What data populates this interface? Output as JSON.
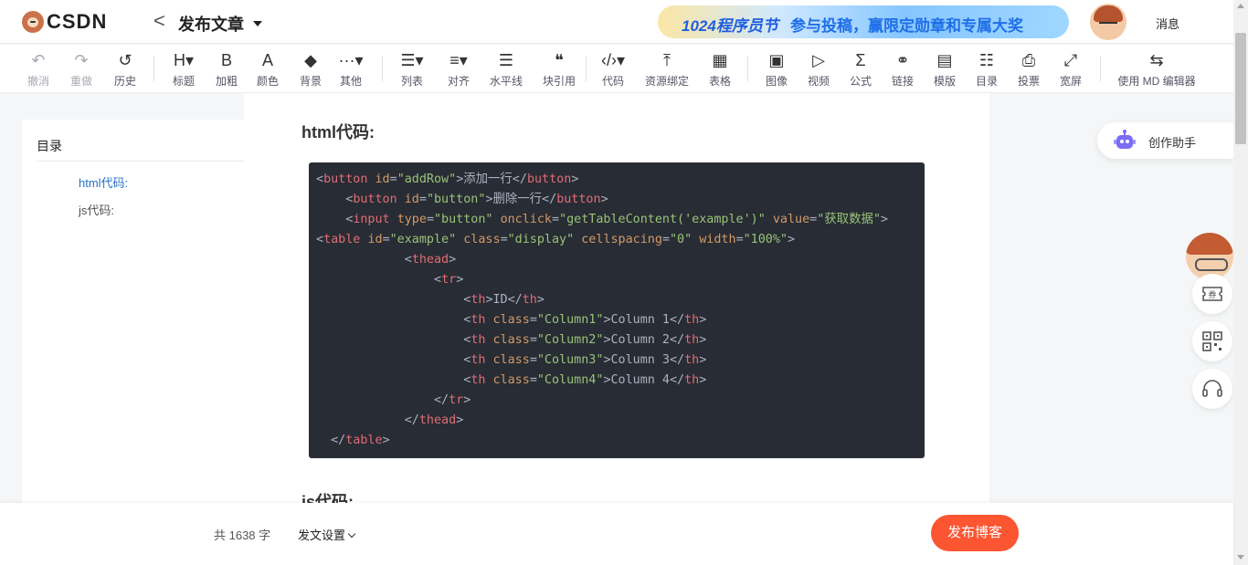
{
  "header": {
    "logo_text": "CSDN",
    "back_label": "<",
    "title": "发布文章",
    "banner_left": "1024程序员节",
    "banner_right": "参与投稿，赢限定勋章和专属大奖",
    "messages_label": "消息"
  },
  "toolbar": {
    "items": [
      {
        "label": "撤消",
        "icon": "undo-icon",
        "glyph": "↶"
      },
      {
        "label": "重做",
        "icon": "redo-icon",
        "glyph": "↷"
      },
      {
        "label": "历史",
        "icon": "history-icon",
        "glyph": "↺"
      },
      {
        "label": "标题",
        "icon": "heading-icon",
        "glyph": "H▾"
      },
      {
        "label": "加粗",
        "icon": "bold-icon",
        "glyph": "B"
      },
      {
        "label": "颜色",
        "icon": "font-color-icon",
        "glyph": "A"
      },
      {
        "label": "背景",
        "icon": "background-color-icon",
        "glyph": "◆"
      },
      {
        "label": "其他",
        "icon": "more-icon",
        "glyph": "···▾"
      },
      {
        "label": "列表",
        "icon": "list-icon",
        "glyph": "☰▾"
      },
      {
        "label": "对齐",
        "icon": "align-icon",
        "glyph": "≡▾"
      },
      {
        "label": "水平线",
        "icon": "horizontal-line-icon",
        "glyph": "☰"
      },
      {
        "label": "块引用",
        "icon": "blockquote-icon",
        "glyph": "❝"
      },
      {
        "label": "代码",
        "icon": "code-icon",
        "glyph": "‹/›▾"
      },
      {
        "label": "资源绑定",
        "icon": "resource-bind-icon",
        "glyph": "⤒"
      },
      {
        "label": "表格",
        "icon": "table-icon",
        "glyph": "▦"
      },
      {
        "label": "图像",
        "icon": "image-icon",
        "glyph": "▣"
      },
      {
        "label": "视频",
        "icon": "video-icon",
        "glyph": "▷"
      },
      {
        "label": "公式",
        "icon": "formula-icon",
        "glyph": "Σ"
      },
      {
        "label": "链接",
        "icon": "link-icon",
        "glyph": "⚭"
      },
      {
        "label": "模版",
        "icon": "template-icon",
        "glyph": "▤"
      },
      {
        "label": "目录",
        "icon": "toc-icon",
        "glyph": "☷"
      },
      {
        "label": "投票",
        "icon": "vote-icon",
        "glyph": "⎙"
      },
      {
        "label": "宽屏",
        "icon": "widescreen-icon",
        "glyph": "⤢"
      },
      {
        "label": "使用 MD 编辑器",
        "icon": "switch-editor-icon",
        "glyph": "⇆"
      }
    ]
  },
  "toc": {
    "title": "目录",
    "items": [
      {
        "label": "html代码:",
        "active": true
      },
      {
        "label": "js代码:",
        "active": false
      }
    ]
  },
  "editor": {
    "heading_html": "html代码:",
    "heading_js": "js代码:"
  },
  "assistant": {
    "label": "创作助手"
  },
  "float_buttons": [
    {
      "icon": "coupon-icon",
      "glyph": "券"
    },
    {
      "icon": "qrcode-icon",
      "glyph": "▦"
    },
    {
      "icon": "headset-icon",
      "glyph": "🎧"
    }
  ],
  "footer": {
    "word_count": "共 1638 字",
    "settings_label": "发文设置",
    "publish_label": "发布博客"
  },
  "colors": {
    "accent": "#fc5531",
    "link": "#2672c4",
    "code_bg": "#282c34"
  }
}
